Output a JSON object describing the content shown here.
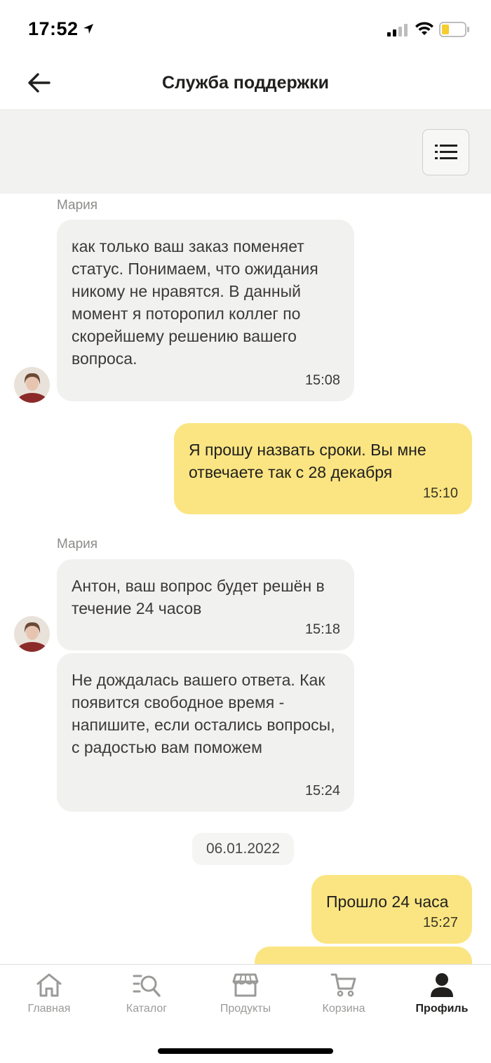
{
  "status_bar": {
    "time": "17:52"
  },
  "header": {
    "title": "Служба поддержки"
  },
  "chat": {
    "blocks": [
      {
        "sender": "Мария",
        "text": "как только ваш заказ поменяет статус. Понимаем, что ожидания никому не нравятся. В данный момент я поторопил коллег по скорейшему решению вашего вопроса.",
        "time": "15:08"
      },
      {
        "text": "Я прошу назвать сроки. Вы мне отвечаете так с 28 декабря",
        "time": "15:10"
      },
      {
        "sender": "Мария",
        "text": "Антон, ваш вопрос будет решён в течение 24 часов",
        "time": "15:18"
      },
      {
        "text": "Не дождалась вашего ответа. Как появится свободное время - напишите, если остались вопросы, с радостью вам поможем",
        "time": "15:24"
      },
      {
        "date": "06.01.2022"
      },
      {
        "text": "Прошло 24 часа",
        "time": "15:27"
      }
    ]
  },
  "tabbar": {
    "tabs": [
      {
        "label": "Главная",
        "icon": "home-icon"
      },
      {
        "label": "Каталог",
        "icon": "catalog-search-icon"
      },
      {
        "label": "Продукты",
        "icon": "store-icon"
      },
      {
        "label": "Корзина",
        "icon": "cart-icon"
      },
      {
        "label": "Профиль",
        "icon": "profile-icon",
        "active": true
      }
    ]
  },
  "colors": {
    "incoming_bubble": "#f1f1f0",
    "outgoing_bubble": "#fbe582",
    "toolbar": "#f2f2f1",
    "battery": "#f5cd2e"
  }
}
